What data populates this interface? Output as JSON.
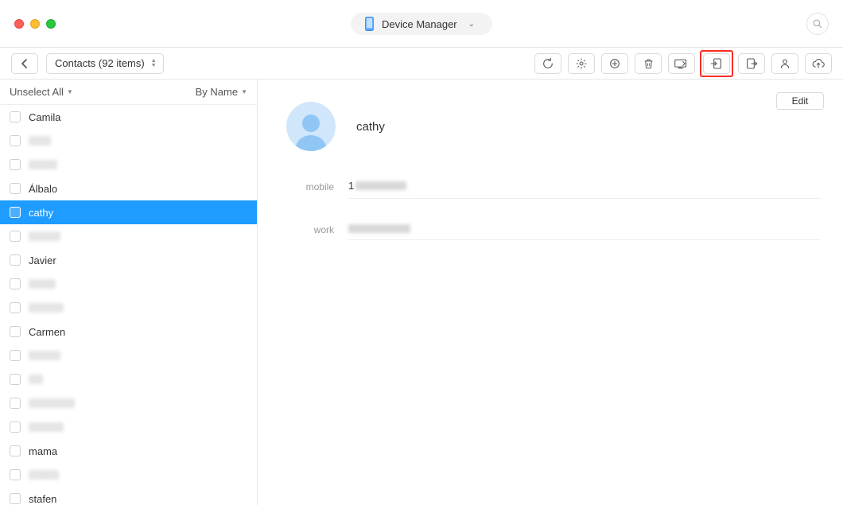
{
  "titlebar": {
    "device_label": "Device Manager"
  },
  "toolbar": {
    "select_label": "Contacts (92 items)"
  },
  "sidebar": {
    "unselect_label": "Unselect All",
    "sort_label": "By Name",
    "rows": [
      {
        "label": "Camila",
        "blurred": false,
        "selected": false
      },
      {
        "label": "",
        "blurred": true,
        "selected": false,
        "blur_w": 28
      },
      {
        "label": "",
        "blurred": true,
        "selected": false,
        "blur_w": 36
      },
      {
        "label": "Álbalo",
        "blurred": false,
        "selected": false
      },
      {
        "label": "cathy",
        "blurred": false,
        "selected": true
      },
      {
        "label": "",
        "blurred": true,
        "selected": false,
        "blur_w": 40
      },
      {
        "label": "Javier",
        "blurred": false,
        "selected": false
      },
      {
        "label": "",
        "blurred": true,
        "selected": false,
        "blur_w": 34
      },
      {
        "label": "",
        "blurred": true,
        "selected": false,
        "blur_w": 44
      },
      {
        "label": "Carmen",
        "blurred": false,
        "selected": false
      },
      {
        "label": "",
        "blurred": true,
        "selected": false,
        "blur_w": 40
      },
      {
        "label": "",
        "blurred": true,
        "selected": false,
        "blur_w": 18
      },
      {
        "label": "",
        "blurred": true,
        "selected": false,
        "blur_w": 58
      },
      {
        "label": "",
        "blurred": true,
        "selected": false,
        "blur_w": 44
      },
      {
        "label": "mama",
        "blurred": false,
        "selected": false
      },
      {
        "label": "",
        "blurred": true,
        "selected": false,
        "blur_w": 38
      },
      {
        "label": "stafen",
        "blurred": false,
        "selected": false
      }
    ]
  },
  "detail": {
    "edit_label": "Edit",
    "name": "cathy",
    "fields": [
      {
        "label": "mobile",
        "value_prefix": "1",
        "value_blur_w": 64
      },
      {
        "label": "work",
        "value_prefix": "",
        "value_blur_w": 78
      }
    ]
  }
}
